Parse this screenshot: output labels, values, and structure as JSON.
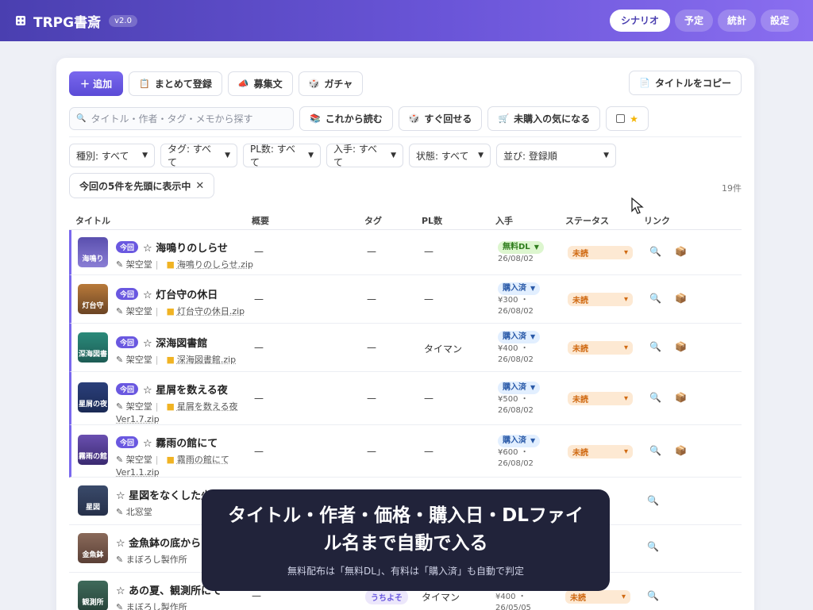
{
  "app": {
    "title": "TRPG書斎",
    "version": "v2.0"
  },
  "nav": [
    "シナリオ",
    "予定",
    "統計",
    "設定"
  ],
  "toolbar": {
    "add": "＋ 追加",
    "bulk": "まとめて登録",
    "recruit": "募集文",
    "gacha": "ガチャ",
    "copy_titles": "タイトルをコピー"
  },
  "search": {
    "placeholder": "タイトル・作者・タグ・メモから探す"
  },
  "quick_filters": [
    "これから読む",
    "すぐ回せる",
    "未購入の気になる"
  ],
  "filters": [
    "種別: すべて",
    "タグ: すべて",
    "PL数: すべて",
    "入手: すべて",
    "状態: すべて",
    "並び: 登録順"
  ],
  "chip": {
    "label": "今回の5件を先頭に表示中",
    "close": "✕"
  },
  "count": "19件",
  "columns": [
    "タイトル",
    "概要",
    "タグ",
    "PL数",
    "入手",
    "ステータス",
    "リンク"
  ],
  "colors": {
    "accent": "#6a58e0",
    "free": "#2f7d1d",
    "purchased": "#2a5aa8",
    "unread": "#d06a12"
  },
  "rows": [
    {
      "thumb": "海鳴り",
      "now": "今回",
      "title": "☆ 海鳴りのしらせ",
      "author": "架空堂",
      "file": "海鳴りのしらせ.zip",
      "file2": "",
      "summary": "—",
      "tag": "—",
      "pl": "—",
      "acq": "無料DL",
      "price": "",
      "date": "26/08/02",
      "status": "未読"
    },
    {
      "thumb": "灯台守",
      "now": "今回",
      "title": "☆ 灯台守の休日",
      "author": "架空堂",
      "file": "灯台守の休日.zip",
      "file2": "",
      "summary": "—",
      "tag": "—",
      "pl": "—",
      "acq": "購入済",
      "price": "¥300 ・",
      "date": "26/08/02",
      "status": "未読"
    },
    {
      "thumb": "深海図書",
      "now": "今回",
      "title": "☆ 深海図書館",
      "author": "架空堂",
      "file": "深海図書館.zip",
      "file2": "",
      "summary": "—",
      "tag": "—",
      "pl": "タイマン",
      "acq": "購入済",
      "price": "¥400 ・",
      "date": "26/08/02",
      "status": "未読"
    },
    {
      "thumb": "星屑の夜",
      "now": "今回",
      "title": "☆ 星屑を数える夜",
      "author": "架空堂",
      "file": "星屑を数える夜",
      "file2": "Ver1.7.zip",
      "summary": "—",
      "tag": "—",
      "pl": "—",
      "acq": "購入済",
      "price": "¥500 ・",
      "date": "26/08/02",
      "status": "未読"
    },
    {
      "thumb": "霧雨の館",
      "now": "今回",
      "title": "☆ 霧雨の館にて",
      "author": "架空堂",
      "file": "霧雨の館にて",
      "file2": "Ver1.1.zip",
      "summary": "—",
      "tag": "—",
      "pl": "—",
      "acq": "購入済",
      "price": "¥600 ・",
      "date": "26/08/02",
      "status": "未読"
    },
    {
      "thumb": "星図",
      "title": "☆ 星図をなくした少年",
      "author": "北窓堂"
    },
    {
      "thumb": "金魚鉢",
      "title": "☆ 金魚鉢の底から",
      "author": "まぼろし製作所"
    },
    {
      "thumb": "観測所",
      "title": "☆ あの夏、観測所にて",
      "author": "まぼろし製作所",
      "summary": "—",
      "tag": "うちよそ",
      "pl": "タイマン",
      "price": "¥400 ・",
      "date": "26/05/05",
      "status": "未読"
    }
  ],
  "overlay": {
    "headline": "タイトル・作者・価格・購入日・DLファイル名まで自動で入る",
    "sub": "無料配布は「無料DL」、有料は「購入済」も自動で判定"
  }
}
